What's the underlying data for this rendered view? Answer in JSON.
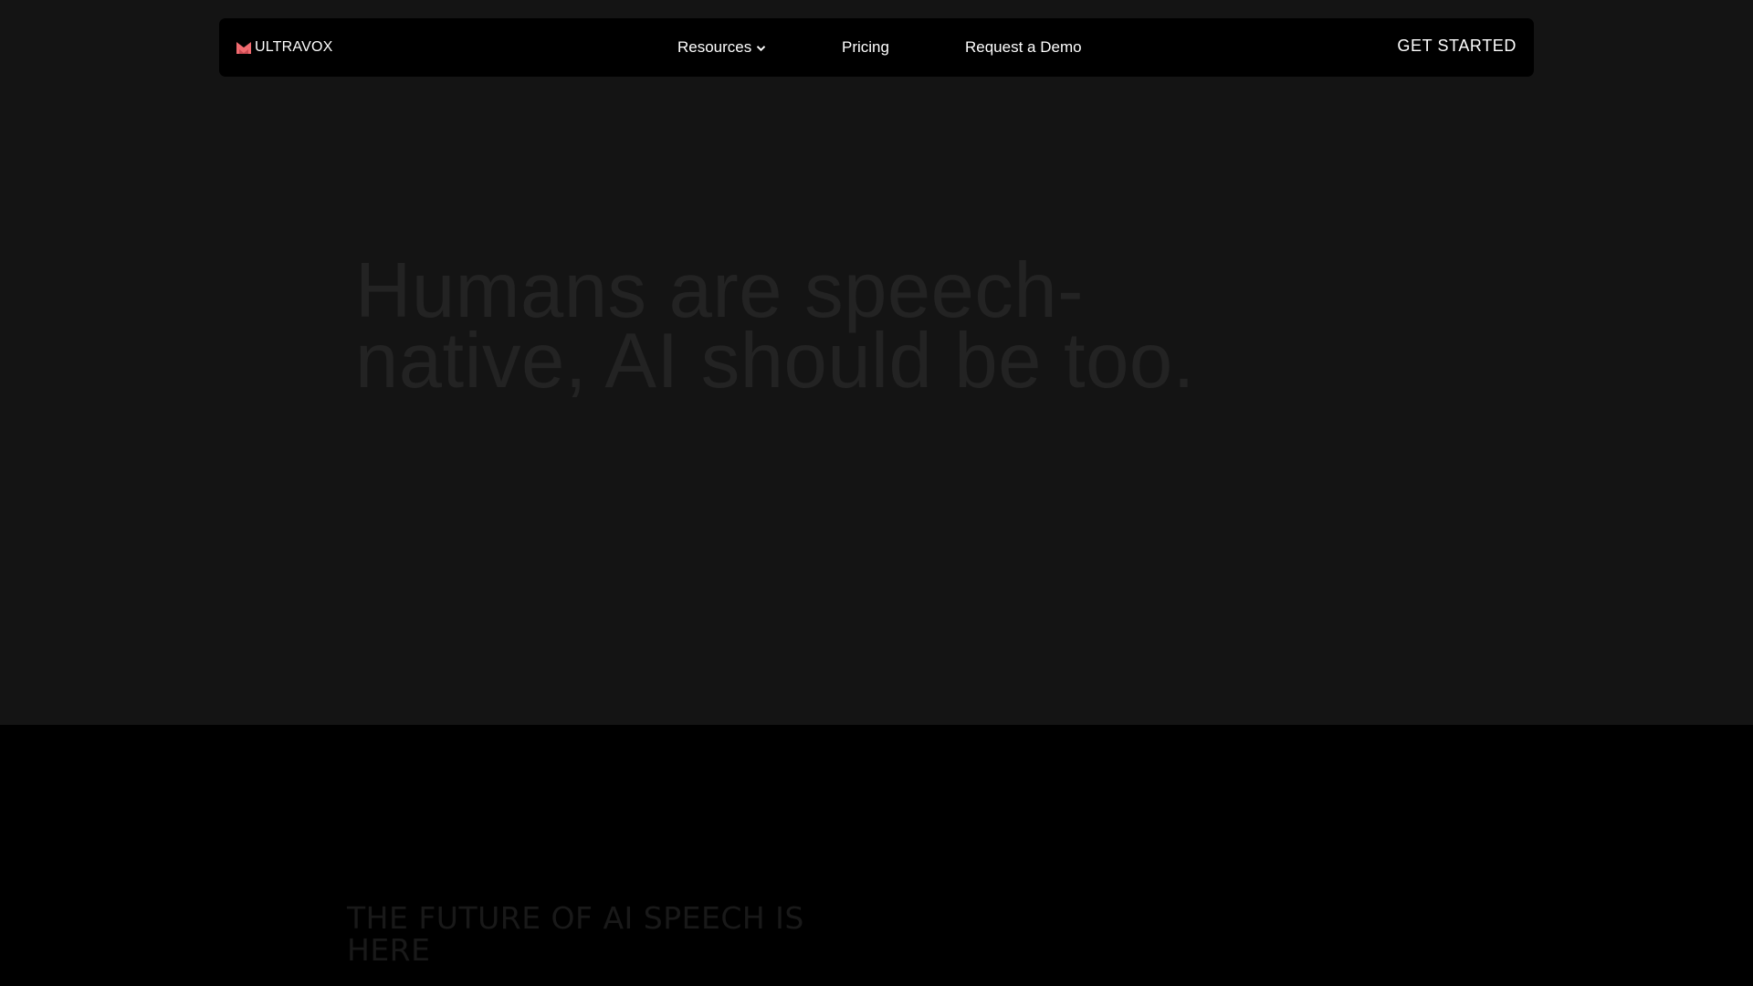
{
  "brand": {
    "name": "ULTRAVOX",
    "logo_color": "#f06a6f"
  },
  "nav": {
    "items": [
      {
        "label": "Resources",
        "icon": "chevron-down-icon"
      },
      {
        "label": "Pricing"
      },
      {
        "label": "Request a Demo"
      }
    ],
    "cta_label": "GET STARTED"
  },
  "hero": {
    "headline": "Humans are speech-native, AI should be too."
  },
  "section": {
    "title": "The future of AI speech is here"
  },
  "colors": {
    "hero_bg": "#141414",
    "page_bg": "#000000",
    "nav_bg": "#000000",
    "nav_text": "#ffffff",
    "headline_text": "#232323"
  }
}
